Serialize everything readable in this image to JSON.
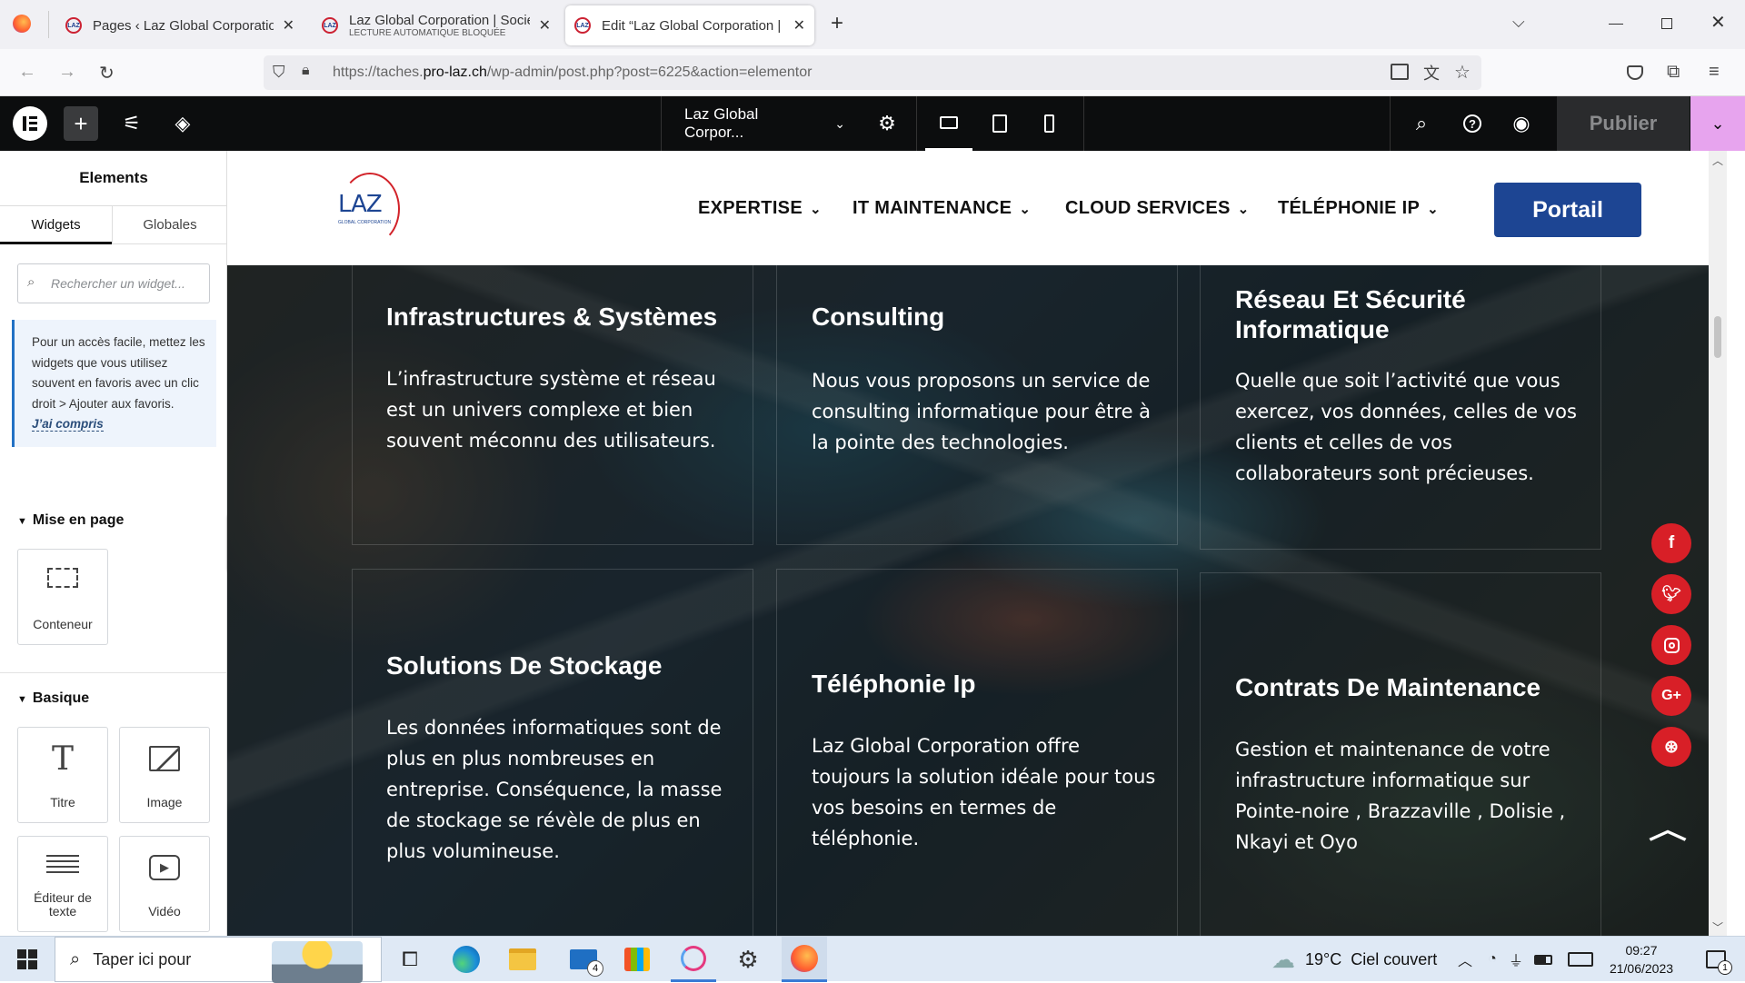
{
  "browser": {
    "tabs": [
      {
        "title": "Pages ‹ Laz Global Corporation",
        "subtitle": ""
      },
      {
        "title": "Laz Global Corporation | Sociét",
        "subtitle": "LECTURE AUTOMATIQUE BLOQUÉE"
      },
      {
        "title": "Edit “Laz Global Corporation | S",
        "subtitle": ""
      }
    ],
    "url_prefix": "https://taches.",
    "url_domain": "pro-laz.ch",
    "url_suffix": "/wp-admin/post.php?post=6225&action=elementor"
  },
  "editor": {
    "page_name": "Laz Global Corpor...",
    "publish_label": "Publier"
  },
  "panel": {
    "title": "Elements",
    "tabs": [
      "Widgets",
      "Globales"
    ],
    "search_placeholder": "Rechercher un widget...",
    "tip_text": "Pour un accès facile, mettez les widgets que vous utilisez souvent en favoris avec un clic droit > Ajouter aux favoris.",
    "tip_link": "J’ai compris",
    "sections": [
      {
        "title": "Mise en page",
        "widgets": [
          "Conteneur"
        ]
      },
      {
        "title": "Basique",
        "widgets": [
          "Titre",
          "Image",
          "Éditeur de texte",
          "Vidéo"
        ]
      }
    ]
  },
  "site": {
    "logo_text": "LAZ",
    "logo_sub": "GLOBAL CORPORATION",
    "menu": [
      "EXPERTISE",
      "IT MAINTENANCE",
      "CLOUD SERVICES",
      "TÉLÉPHONIE IP"
    ],
    "portal_button": "Portail",
    "services": [
      {
        "title": "Infrastructures & Systèmes",
        "text": "L’infrastructure système et réseau est un univers complexe et bien souvent méconnu des utilisateurs."
      },
      {
        "title": "Consulting",
        "text": "Nous vous proposons un service de consulting informatique pour être à la pointe des technologies."
      },
      {
        "title": "Réseau Et Sécurité Informatique",
        "text": "Quelle que soit l’activité que vous exercez, vos données, celles de vos clients et celles de vos collaborateurs sont précieuses."
      },
      {
        "title": "Solutions De Stockage",
        "text": "Les données informatiques sont de plus en plus nombreuses en entreprise. Conséquence, la masse de stockage se révèle de plus en plus volumineuse."
      },
      {
        "title": "Téléphonie Ip",
        "text": "Laz Global Corporation offre toujours la solution idéale pour tous vos besoins en termes de téléphonie."
      },
      {
        "title": "Contrats De Maintenance",
        "text": "Gestion et maintenance de votre infrastructure informatique sur Pointe-noire , Brazzaville , Dolisie , Nkayi et Oyo"
      }
    ],
    "social": [
      "facebook-icon",
      "twitter-icon",
      "instagram-icon",
      "google-plus-icon",
      "dribbble-icon"
    ]
  },
  "taskbar": {
    "search_text": "Taper ici pour",
    "weather": "19°C  Ciel couvert",
    "time": "09:27",
    "date": "21/06/2023",
    "mail_badge": "4",
    "notif_count": "1"
  },
  "colors": {
    "accent_pink": "#e7a4ee",
    "brand_blue": "#1d4593",
    "social_red": "#d81f27",
    "elementor_dark": "#0c0d0e"
  }
}
